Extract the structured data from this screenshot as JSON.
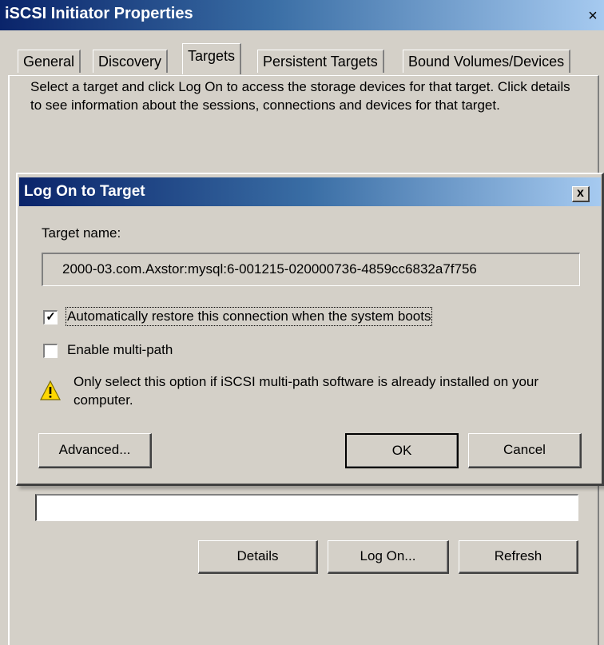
{
  "outer_window": {
    "title": "iSCSI Initiator Properties",
    "close_label": "×",
    "tabs": [
      {
        "label": "General"
      },
      {
        "label": "Discovery"
      },
      {
        "label": "Targets"
      },
      {
        "label": "Persistent Targets"
      },
      {
        "label": "Bound Volumes/Devices"
      }
    ],
    "active_tab": "Targets",
    "description": "Select a target and click Log On to access the storage devices for that target. Click details to see information about the sessions, connections and devices for that target.",
    "buttons": {
      "details": "Details",
      "log_on": "Log On...",
      "refresh": "Refresh"
    }
  },
  "dialog": {
    "title": "Log On to Target",
    "close_label": "x",
    "target_name_label": "Target name:",
    "target_name_value": "2000-03.com.Axstor:mysql:6-001215-020000736-4859cc6832a7f756",
    "auto_restore": {
      "label": "Automatically restore this connection when the system boots",
      "checked": true
    },
    "multipath": {
      "label": "Enable multi-path",
      "checked": false
    },
    "warning_text": "Only select this option if iSCSI multi-path software is already installed on your computer.",
    "warning_icon": "warning-triangle-icon",
    "buttons": {
      "advanced": "Advanced...",
      "ok": "OK",
      "cancel": "Cancel"
    }
  },
  "colors": {
    "titlebar_dark": "#0a246a",
    "titlebar_light": "#a6caf0",
    "face": "#d4d0c8"
  }
}
